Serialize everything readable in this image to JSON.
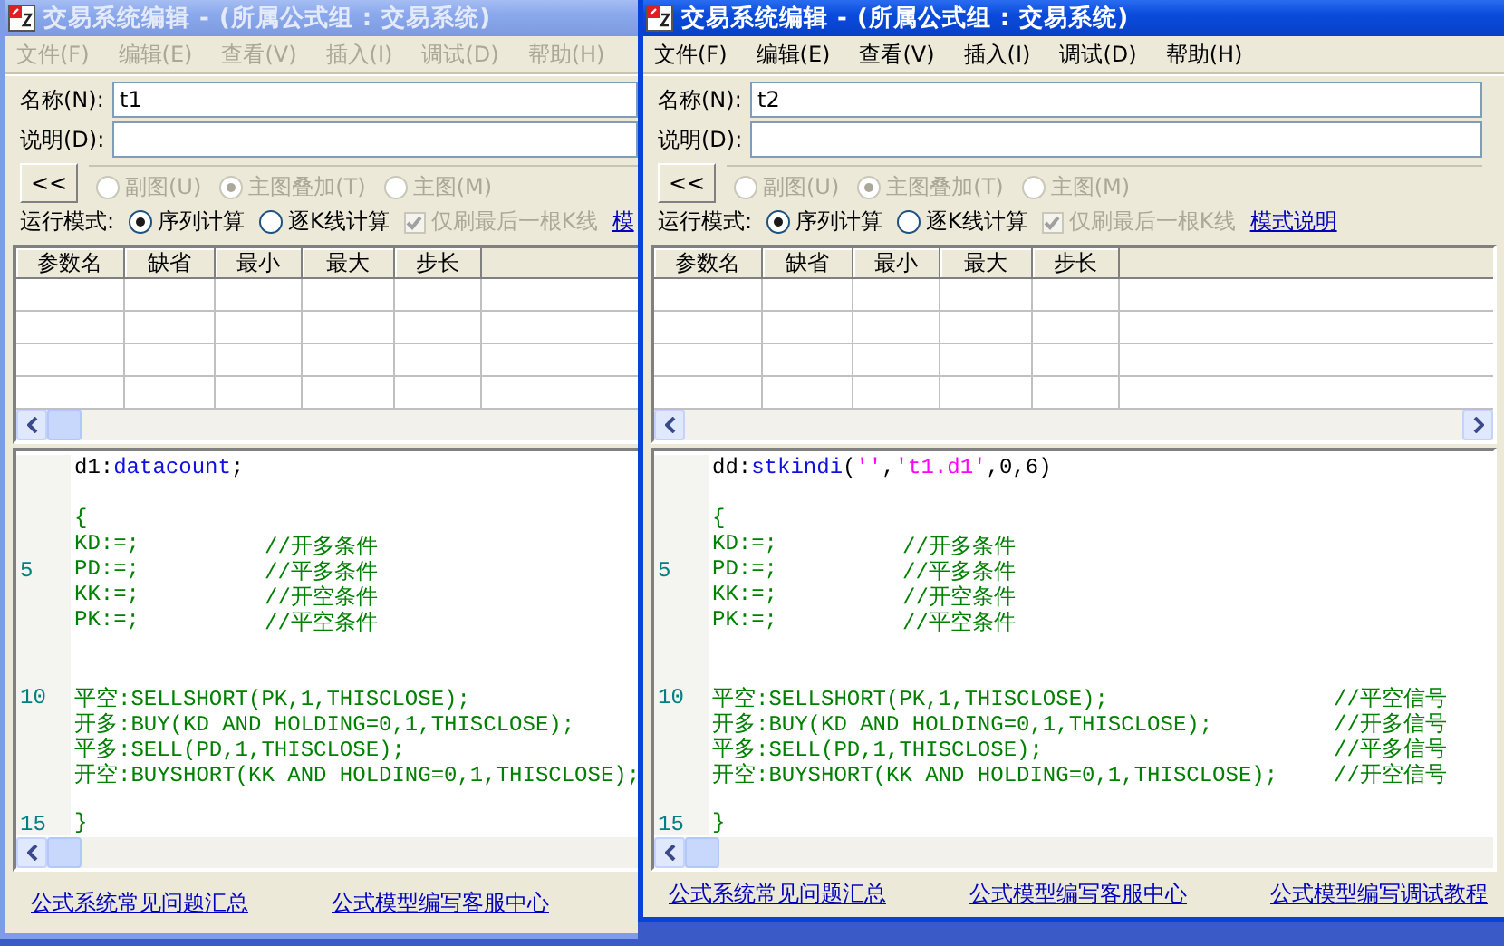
{
  "windows": [
    {
      "active": false,
      "title": "交易系统编辑 - (所属公式组 : 交易系统)",
      "menu": [
        "文件(F)",
        "编辑(E)",
        "查看(V)",
        "插入(I)",
        "调试(D)",
        "帮助(H)"
      ],
      "name_label": "名称(N):",
      "name_value": "t1",
      "description_label": "说明(D):",
      "collapse_button": "<<",
      "chart_options": [
        {
          "label": "副图(U)",
          "selected": false,
          "disabled": true
        },
        {
          "label": "主图叠加(T)",
          "selected": true,
          "disabled": true
        },
        {
          "label": "主图(M)",
          "selected": false,
          "disabled": true
        }
      ],
      "mode_label": "运行模式:",
      "modes": [
        {
          "label": "序列计算",
          "selected": true
        },
        {
          "label": "逐K线计算",
          "selected": false
        }
      ],
      "refresh_option": {
        "label": "仅刷最后一根K线",
        "checked": true,
        "disabled": true
      },
      "mode_link": "模",
      "params_table": {
        "columns": [
          "参数名",
          "缺省",
          "最小",
          "最大",
          "步长"
        ]
      },
      "editor": {
        "lines": [
          {
            "kind": "code",
            "segments": [
              {
                "kind": "plain",
                "text": "d1:"
              },
              {
                "kind": "function",
                "text": "datacount"
              },
              {
                "kind": "plain",
                "text": ";"
              }
            ]
          },
          {
            "kind": "blank"
          },
          {
            "kind": "code",
            "segments": [
              {
                "kind": "green",
                "text": "{"
              }
            ]
          },
          {
            "kind": "decl",
            "segments": [
              {
                "kind": "green",
                "text": "KD:=;"
              }
            ],
            "comment": "//开多条件"
          },
          {
            "kind": "decl",
            "number": "5",
            "segments": [
              {
                "kind": "green",
                "text": "PD:=;"
              }
            ],
            "comment": "//平多条件"
          },
          {
            "kind": "decl",
            "segments": [
              {
                "kind": "green",
                "text": "KK:=;"
              }
            ],
            "comment": "//开空条件"
          },
          {
            "kind": "decl",
            "segments": [
              {
                "kind": "green",
                "text": "PK:=;"
              }
            ],
            "comment": "//平空条件"
          },
          {
            "kind": "blank"
          },
          {
            "kind": "blank"
          },
          {
            "kind": "code",
            "number": "10",
            "segments": [
              {
                "kind": "green",
                "text": "平空:SELLSHORT(PK,1,THISCLOSE);"
              }
            ]
          },
          {
            "kind": "code",
            "segments": [
              {
                "kind": "green",
                "text": "开多:BUY(KD AND HOLDING=0,1,THISCLOSE);"
              }
            ]
          },
          {
            "kind": "code",
            "segments": [
              {
                "kind": "green",
                "text": "平多:SELL(PD,1,THISCLOSE);"
              }
            ]
          },
          {
            "kind": "code",
            "segments": [
              {
                "kind": "green",
                "text": "开空:BUYSHORT(KK AND HOLDING=0,1,THISCLOSE);"
              }
            ]
          },
          {
            "kind": "blank"
          },
          {
            "kind": "code",
            "number": "15",
            "segments": [
              {
                "kind": "green",
                "text": "}"
              }
            ]
          }
        ]
      },
      "footer_links": [
        "公式系统常见问题汇总",
        "公式模型编写客服中心"
      ]
    },
    {
      "active": true,
      "title": "交易系统编辑 - (所属公式组 : 交易系统)",
      "menu": [
        "文件(F)",
        "编辑(E)",
        "查看(V)",
        "插入(I)",
        "调试(D)",
        "帮助(H)"
      ],
      "name_label": "名称(N):",
      "name_value": "t2",
      "description_label": "说明(D):",
      "collapse_button": "<<",
      "chart_options": [
        {
          "label": "副图(U)",
          "selected": false,
          "disabled": true
        },
        {
          "label": "主图叠加(T)",
          "selected": true,
          "disabled": true
        },
        {
          "label": "主图(M)",
          "selected": false,
          "disabled": true
        }
      ],
      "mode_label": "运行模式:",
      "modes": [
        {
          "label": "序列计算",
          "selected": true
        },
        {
          "label": "逐K线计算",
          "selected": false
        }
      ],
      "refresh_option": {
        "label": "仅刷最后一根K线",
        "checked": true,
        "disabled": true
      },
      "mode_link": "模式说明",
      "params_table": {
        "columns": [
          "参数名",
          "缺省",
          "最小",
          "最大",
          "步长"
        ]
      },
      "editor": {
        "lines": [
          {
            "kind": "code",
            "segments": [
              {
                "kind": "plain",
                "text": "dd:"
              },
              {
                "kind": "function",
                "text": "stkindi"
              },
              {
                "kind": "plain",
                "text": "("
              },
              {
                "kind": "string",
                "text": "''"
              },
              {
                "kind": "plain",
                "text": ","
              },
              {
                "kind": "string",
                "text": "'t1.d1'"
              },
              {
                "kind": "plain",
                "text": ",0,6)"
              }
            ]
          },
          {
            "kind": "blank"
          },
          {
            "kind": "code",
            "segments": [
              {
                "kind": "green",
                "text": "{"
              }
            ]
          },
          {
            "kind": "decl",
            "segments": [
              {
                "kind": "green",
                "text": "KD:=;"
              }
            ],
            "comment": "//开多条件"
          },
          {
            "kind": "decl",
            "number": "5",
            "segments": [
              {
                "kind": "green",
                "text": "PD:=;"
              }
            ],
            "comment": "//平多条件"
          },
          {
            "kind": "decl",
            "segments": [
              {
                "kind": "green",
                "text": "KK:=;"
              }
            ],
            "comment": "//开空条件"
          },
          {
            "kind": "decl",
            "segments": [
              {
                "kind": "green",
                "text": "PK:=;"
              }
            ],
            "comment": "//平空条件"
          },
          {
            "kind": "blank"
          },
          {
            "kind": "blank"
          },
          {
            "kind": "signal",
            "number": "10",
            "segments": [
              {
                "kind": "green",
                "text": "平空:SELLSHORT(PK,1,THISCLOSE);"
              }
            ],
            "comment": "//平空信号"
          },
          {
            "kind": "signal",
            "segments": [
              {
                "kind": "green",
                "text": "开多:BUY(KD AND HOLDING=0,1,THISCLOSE);"
              }
            ],
            "comment": "//开多信号"
          },
          {
            "kind": "signal",
            "segments": [
              {
                "kind": "green",
                "text": "平多:SELL(PD,1,THISCLOSE);"
              }
            ],
            "comment": "//平多信号"
          },
          {
            "kind": "signal",
            "segments": [
              {
                "kind": "green",
                "text": "开空:BUYSHORT(KK AND HOLDING=0,1,THISCLOSE);"
              }
            ],
            "comment": "//开空信号"
          },
          {
            "kind": "blank"
          },
          {
            "kind": "code",
            "number": "15",
            "segments": [
              {
                "kind": "green",
                "text": "}"
              }
            ]
          }
        ]
      },
      "footer_links": [
        "公式系统常见问题汇总",
        "公式模型编写客服中心",
        "公式模型编写调试教程"
      ]
    }
  ]
}
